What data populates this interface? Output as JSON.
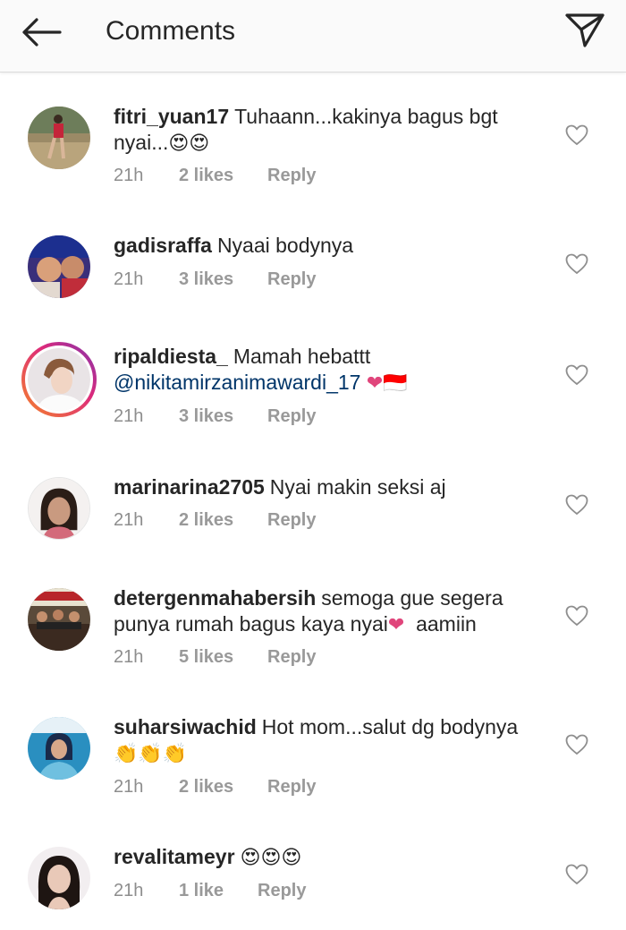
{
  "header": {
    "title": "Comments",
    "back_icon": "arrow-left-icon",
    "share_icon": "send-icon"
  },
  "comments": [
    {
      "username": "fitri_yuan17",
      "text": "Tuhaann...kakinya bagus bgt nyai...",
      "emoji": "😍😍",
      "time": "21h",
      "likes": "2 likes",
      "reply": "Reply"
    },
    {
      "username": "gadisraffa",
      "text": "Nyaai bodynya",
      "emoji": "",
      "time": "21h",
      "likes": "3 likes",
      "reply": "Reply"
    },
    {
      "username": "ripaldiesta_",
      "text": "Mamah hebattt",
      "mention": "@nikitamirzanimawardi_17",
      "emoji": "❤🇮🇩",
      "time": "21h",
      "likes": "3 likes",
      "reply": "Reply"
    },
    {
      "username": "marinarina2705",
      "text": "Nyai makin seksi aj",
      "emoji": "",
      "time": "21h",
      "likes": "2 likes",
      "reply": "Reply"
    },
    {
      "username": "detergenmahabersih",
      "text": "semoga gue segera punya rumah bagus kaya nyai",
      "emoji": "❤",
      "text_after": "aamiin",
      "time": "21h",
      "likes": "5 likes",
      "reply": "Reply"
    },
    {
      "username": "suharsiwachid",
      "text": "Hot mom...salut dg bodynya",
      "emoji": "👏👏👏",
      "time": "21h",
      "likes": "2 likes",
      "reply": "Reply"
    },
    {
      "username": "revalitameyr",
      "text": "",
      "emoji": "😍😍😍",
      "time": "21h",
      "likes": "1 like",
      "reply": "Reply"
    }
  ]
}
